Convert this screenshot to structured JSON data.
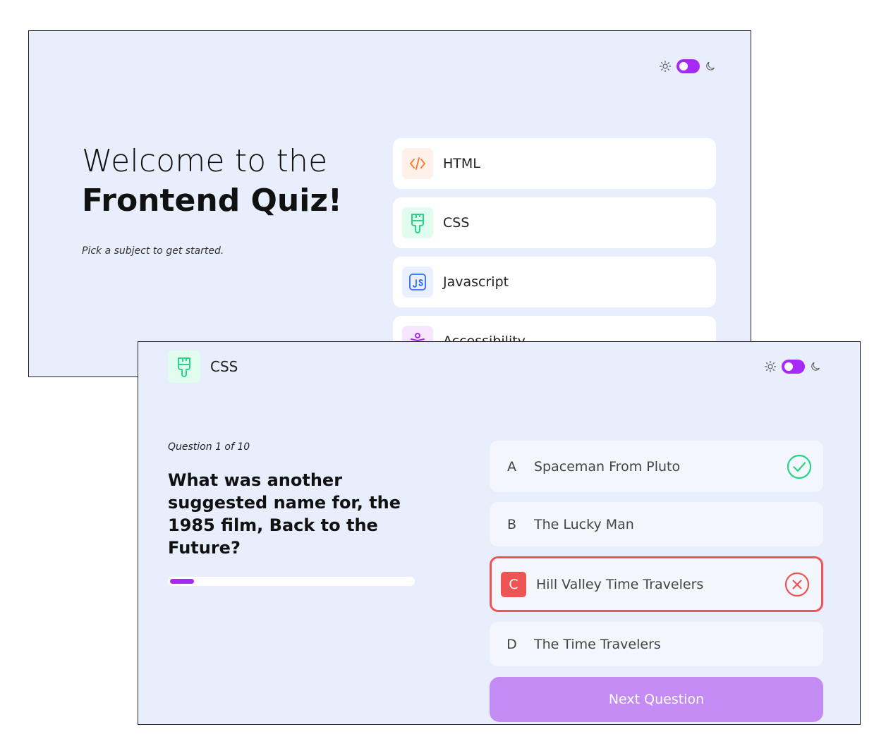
{
  "home": {
    "welcome_line1": "Welcome to the",
    "welcome_line2": "Frontend Quiz!",
    "subtitle": "Pick a subject to get started.",
    "subjects": [
      {
        "label": "HTML",
        "icon": "code-brackets-icon",
        "color": "#ff7e35",
        "bg": "#fff1e9"
      },
      {
        "label": "CSS",
        "icon": "paintbrush-icon",
        "color": "#26d782",
        "bg": "#e0fdef"
      },
      {
        "label": "Javascript",
        "icon": "js-icon",
        "color": "#306aff",
        "bg": "#ebf0ff"
      },
      {
        "label": "Accessibility",
        "icon": "accessibility-icon",
        "color": "#a729f5",
        "bg": "#f6e7ff"
      }
    ],
    "theme_toggle": {
      "light_icon": "sun-icon",
      "dark_icon": "moon-icon",
      "accent": "#a729f5"
    }
  },
  "quiz": {
    "subject": {
      "label": "CSS",
      "icon": "paintbrush-icon",
      "color": "#26d782",
      "bg": "#e0fdef"
    },
    "question_count": "Question 1 of 10",
    "question": "What was another suggested name for, the 1985 film, Back to the Future?",
    "progress": 0.1,
    "answers": [
      {
        "letter": "A",
        "text": "Spaceman From Pluto",
        "state": "correct"
      },
      {
        "letter": "B",
        "text": "The Lucky Man",
        "state": "default"
      },
      {
        "letter": "C",
        "text": "Hill Valley Time Travelers",
        "state": "wrong"
      },
      {
        "letter": "D",
        "text": "The Time Travelers",
        "state": "default"
      }
    ],
    "next_button": "Next Question",
    "colors": {
      "correct": "#26d782",
      "wrong": "#ee5454",
      "accent": "#a729f5"
    }
  }
}
